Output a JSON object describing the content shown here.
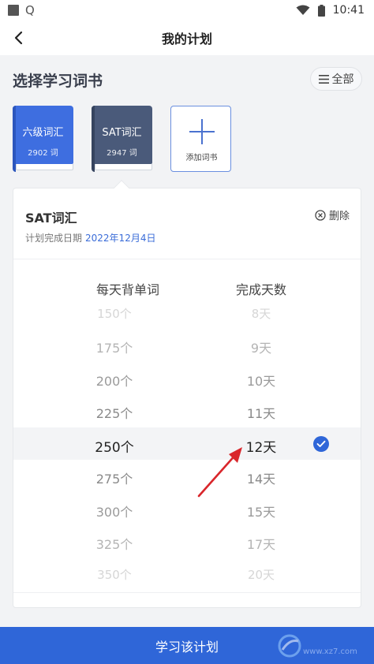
{
  "status_bar": {
    "time": "10:41",
    "q_glyph": "Q"
  },
  "header": {
    "title": "我的计划"
  },
  "section": {
    "title": "选择学习词书",
    "all_button": "全部"
  },
  "books": [
    {
      "name": "六级词汇",
      "count": "2902 词",
      "color": "#3e6ee0"
    },
    {
      "name": "SAT词汇",
      "count": "2947 词",
      "color": "#4a5a7a"
    }
  ],
  "add_book_label": "添加词书",
  "plan": {
    "book_title": "SAT词汇",
    "delete_label": "删除",
    "date_label": "计划完成日期",
    "date_value": "2022年12月4日",
    "daily_words_header": "每天背单词",
    "days_header": "完成天数",
    "daily_words_options": [
      "150个",
      "175个",
      "200个",
      "225个",
      "250个",
      "275个",
      "300个",
      "325个",
      "350个"
    ],
    "selected_daily_words": "250个",
    "days_options": [
      "8天",
      "9天",
      "10天",
      "11天",
      "12天",
      "14天",
      "15天",
      "17天",
      "20天"
    ],
    "selected_days": "12天"
  },
  "bottom_button": "学习该计划",
  "watermark": "www.xz7.com",
  "colors": {
    "accent": "#2f66d8",
    "annotation": "#d9262b"
  }
}
